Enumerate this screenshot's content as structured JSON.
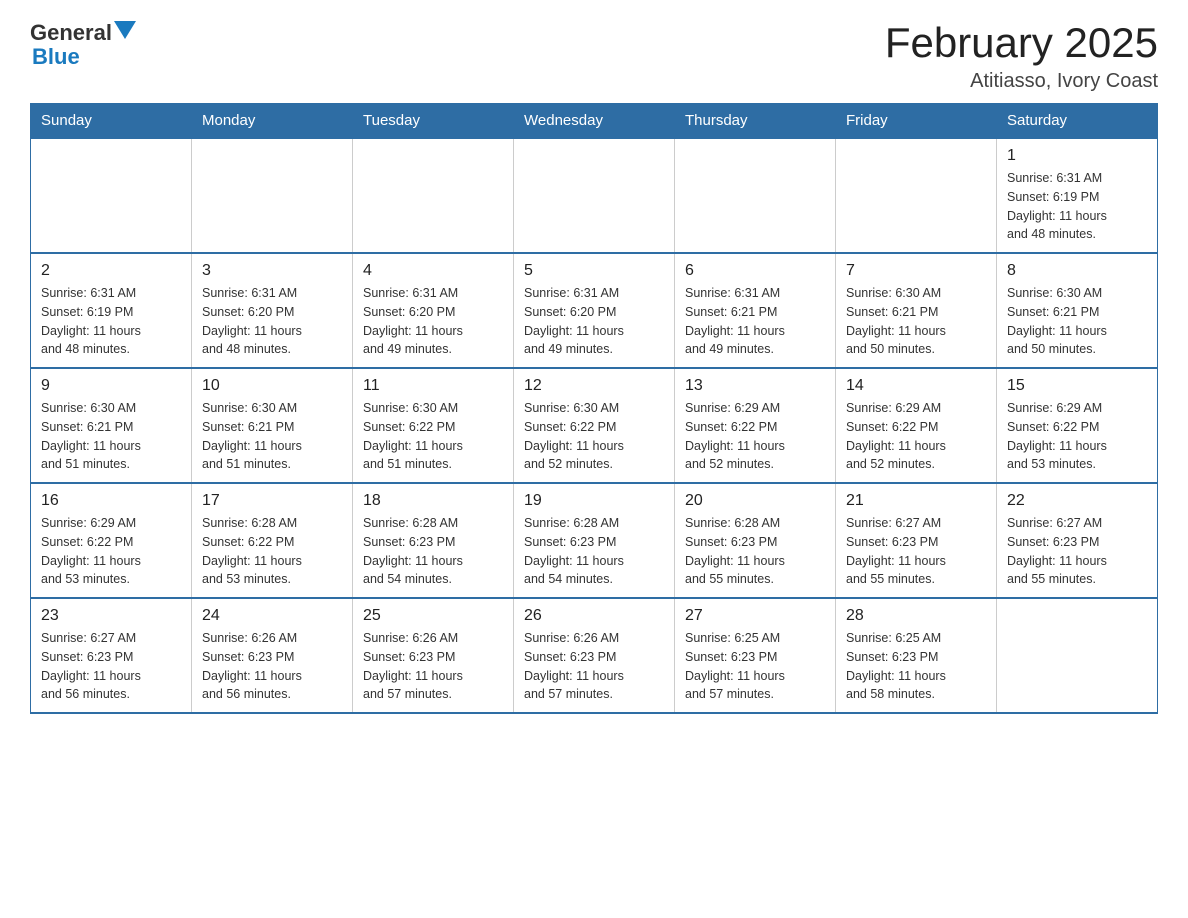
{
  "header": {
    "title": "February 2025",
    "subtitle": "Atitiasso, Ivory Coast",
    "logo_general": "General",
    "logo_blue": "Blue"
  },
  "weekdays": [
    "Sunday",
    "Monday",
    "Tuesday",
    "Wednesday",
    "Thursday",
    "Friday",
    "Saturday"
  ],
  "weeks": [
    [
      {
        "day": "",
        "info": ""
      },
      {
        "day": "",
        "info": ""
      },
      {
        "day": "",
        "info": ""
      },
      {
        "day": "",
        "info": ""
      },
      {
        "day": "",
        "info": ""
      },
      {
        "day": "",
        "info": ""
      },
      {
        "day": "1",
        "info": "Sunrise: 6:31 AM\nSunset: 6:19 PM\nDaylight: 11 hours\nand 48 minutes."
      }
    ],
    [
      {
        "day": "2",
        "info": "Sunrise: 6:31 AM\nSunset: 6:19 PM\nDaylight: 11 hours\nand 48 minutes."
      },
      {
        "day": "3",
        "info": "Sunrise: 6:31 AM\nSunset: 6:20 PM\nDaylight: 11 hours\nand 48 minutes."
      },
      {
        "day": "4",
        "info": "Sunrise: 6:31 AM\nSunset: 6:20 PM\nDaylight: 11 hours\nand 49 minutes."
      },
      {
        "day": "5",
        "info": "Sunrise: 6:31 AM\nSunset: 6:20 PM\nDaylight: 11 hours\nand 49 minutes."
      },
      {
        "day": "6",
        "info": "Sunrise: 6:31 AM\nSunset: 6:21 PM\nDaylight: 11 hours\nand 49 minutes."
      },
      {
        "day": "7",
        "info": "Sunrise: 6:30 AM\nSunset: 6:21 PM\nDaylight: 11 hours\nand 50 minutes."
      },
      {
        "day": "8",
        "info": "Sunrise: 6:30 AM\nSunset: 6:21 PM\nDaylight: 11 hours\nand 50 minutes."
      }
    ],
    [
      {
        "day": "9",
        "info": "Sunrise: 6:30 AM\nSunset: 6:21 PM\nDaylight: 11 hours\nand 51 minutes."
      },
      {
        "day": "10",
        "info": "Sunrise: 6:30 AM\nSunset: 6:21 PM\nDaylight: 11 hours\nand 51 minutes."
      },
      {
        "day": "11",
        "info": "Sunrise: 6:30 AM\nSunset: 6:22 PM\nDaylight: 11 hours\nand 51 minutes."
      },
      {
        "day": "12",
        "info": "Sunrise: 6:30 AM\nSunset: 6:22 PM\nDaylight: 11 hours\nand 52 minutes."
      },
      {
        "day": "13",
        "info": "Sunrise: 6:29 AM\nSunset: 6:22 PM\nDaylight: 11 hours\nand 52 minutes."
      },
      {
        "day": "14",
        "info": "Sunrise: 6:29 AM\nSunset: 6:22 PM\nDaylight: 11 hours\nand 52 minutes."
      },
      {
        "day": "15",
        "info": "Sunrise: 6:29 AM\nSunset: 6:22 PM\nDaylight: 11 hours\nand 53 minutes."
      }
    ],
    [
      {
        "day": "16",
        "info": "Sunrise: 6:29 AM\nSunset: 6:22 PM\nDaylight: 11 hours\nand 53 minutes."
      },
      {
        "day": "17",
        "info": "Sunrise: 6:28 AM\nSunset: 6:22 PM\nDaylight: 11 hours\nand 53 minutes."
      },
      {
        "day": "18",
        "info": "Sunrise: 6:28 AM\nSunset: 6:23 PM\nDaylight: 11 hours\nand 54 minutes."
      },
      {
        "day": "19",
        "info": "Sunrise: 6:28 AM\nSunset: 6:23 PM\nDaylight: 11 hours\nand 54 minutes."
      },
      {
        "day": "20",
        "info": "Sunrise: 6:28 AM\nSunset: 6:23 PM\nDaylight: 11 hours\nand 55 minutes."
      },
      {
        "day": "21",
        "info": "Sunrise: 6:27 AM\nSunset: 6:23 PM\nDaylight: 11 hours\nand 55 minutes."
      },
      {
        "day": "22",
        "info": "Sunrise: 6:27 AM\nSunset: 6:23 PM\nDaylight: 11 hours\nand 55 minutes."
      }
    ],
    [
      {
        "day": "23",
        "info": "Sunrise: 6:27 AM\nSunset: 6:23 PM\nDaylight: 11 hours\nand 56 minutes."
      },
      {
        "day": "24",
        "info": "Sunrise: 6:26 AM\nSunset: 6:23 PM\nDaylight: 11 hours\nand 56 minutes."
      },
      {
        "day": "25",
        "info": "Sunrise: 6:26 AM\nSunset: 6:23 PM\nDaylight: 11 hours\nand 57 minutes."
      },
      {
        "day": "26",
        "info": "Sunrise: 6:26 AM\nSunset: 6:23 PM\nDaylight: 11 hours\nand 57 minutes."
      },
      {
        "day": "27",
        "info": "Sunrise: 6:25 AM\nSunset: 6:23 PM\nDaylight: 11 hours\nand 57 minutes."
      },
      {
        "day": "28",
        "info": "Sunrise: 6:25 AM\nSunset: 6:23 PM\nDaylight: 11 hours\nand 58 minutes."
      },
      {
        "day": "",
        "info": ""
      }
    ]
  ]
}
